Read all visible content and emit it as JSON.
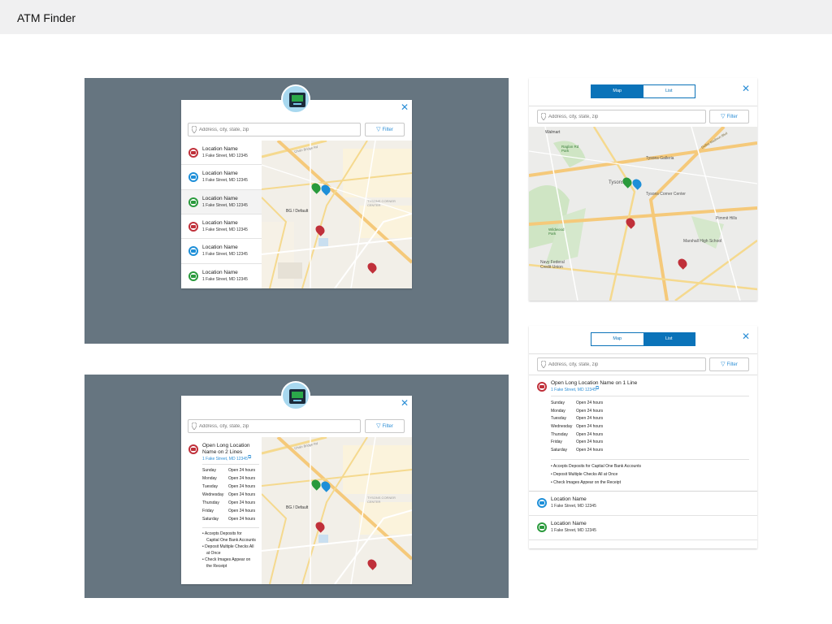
{
  "app": {
    "title": "ATM Finder"
  },
  "search": {
    "placeholder": "Address, city, state, zip",
    "filter_label": "Filter"
  },
  "toggle": {
    "map_label": "Map",
    "list_label": "List"
  },
  "locations": [
    {
      "name": "Location Name",
      "address": "1 Fake Street, MD 12345",
      "type": "red"
    },
    {
      "name": "Location Name",
      "address": "1 Fake Street, MD 12345",
      "type": "blue"
    },
    {
      "name": "Location Name",
      "address": "1 Fake Street, MD 12345",
      "type": "green"
    },
    {
      "name": "Location Name",
      "address": "1 Fake Street, MD 12345",
      "type": "red"
    },
    {
      "name": "Location Name",
      "address": "1 Fake Street, MD 12345",
      "type": "blue"
    },
    {
      "name": "Location Name",
      "address": "1 Fake Street, MD 12345",
      "type": "green"
    }
  ],
  "detail_two_line": {
    "name_line1": "Open Long Location",
    "name_line2": "Name on 2 Lines",
    "address": "1 Fake Street, MD 12345"
  },
  "detail_one_line": {
    "name": "Open Long Location Name on 1 Line",
    "address": "1 Fake Street, MD 12345"
  },
  "hours": [
    {
      "day": "Sunday",
      "value": "Open 24 hours"
    },
    {
      "day": "Monday",
      "value": "Open 24 hours"
    },
    {
      "day": "Tuesday",
      "value": "Open 24 hours"
    },
    {
      "day": "Wednesday",
      "value": "Open 24 hours"
    },
    {
      "day": "Thursday",
      "value": "Open 24 hours"
    },
    {
      "day": "Friday",
      "value": "Open 24 hours"
    },
    {
      "day": "Saturday",
      "value": "Open 24 hours"
    }
  ],
  "features_narrow": [
    {
      "line1": "Accepts Deposits for",
      "line2": "Captial One Bank Accounts"
    },
    {
      "line1": "Deposit Multiple Checks All",
      "line2": "at Once"
    },
    {
      "line1": "Check Images Appear on",
      "line2": "the Receipt"
    }
  ],
  "features_wide": [
    "Accepts Deposits for Captial One Bank Accounts",
    "Deposit Multiple Checks All at Once",
    "Check Images Appear on the Receipt"
  ],
  "map_labels": {
    "bg_default": "BG / Default",
    "tysons_corner_center": "TYSONS CORNER CENTER",
    "chain_bridge": "Chain Bridge Rd",
    "walmart": "Walmart",
    "raglan": "Raglan Rd Park",
    "tysons_galleria": "Tysons Galleria",
    "tysons": "Tysons",
    "tysons_corner_center_mobile": "Tysons Corner Center",
    "pimmit_hills": "Pimmit Hills",
    "marshall": "Marshall High School",
    "wildwood": "Wildwood Park",
    "navy_federal": "Navy Federal Credit Union",
    "dolley_madison": "Dolley Madison Blvd"
  },
  "colors": {
    "red": "#c0303a",
    "blue": "#1e8fd8",
    "green": "#2a9a3c",
    "stage": "#667580",
    "accent": "#0b73b9"
  }
}
